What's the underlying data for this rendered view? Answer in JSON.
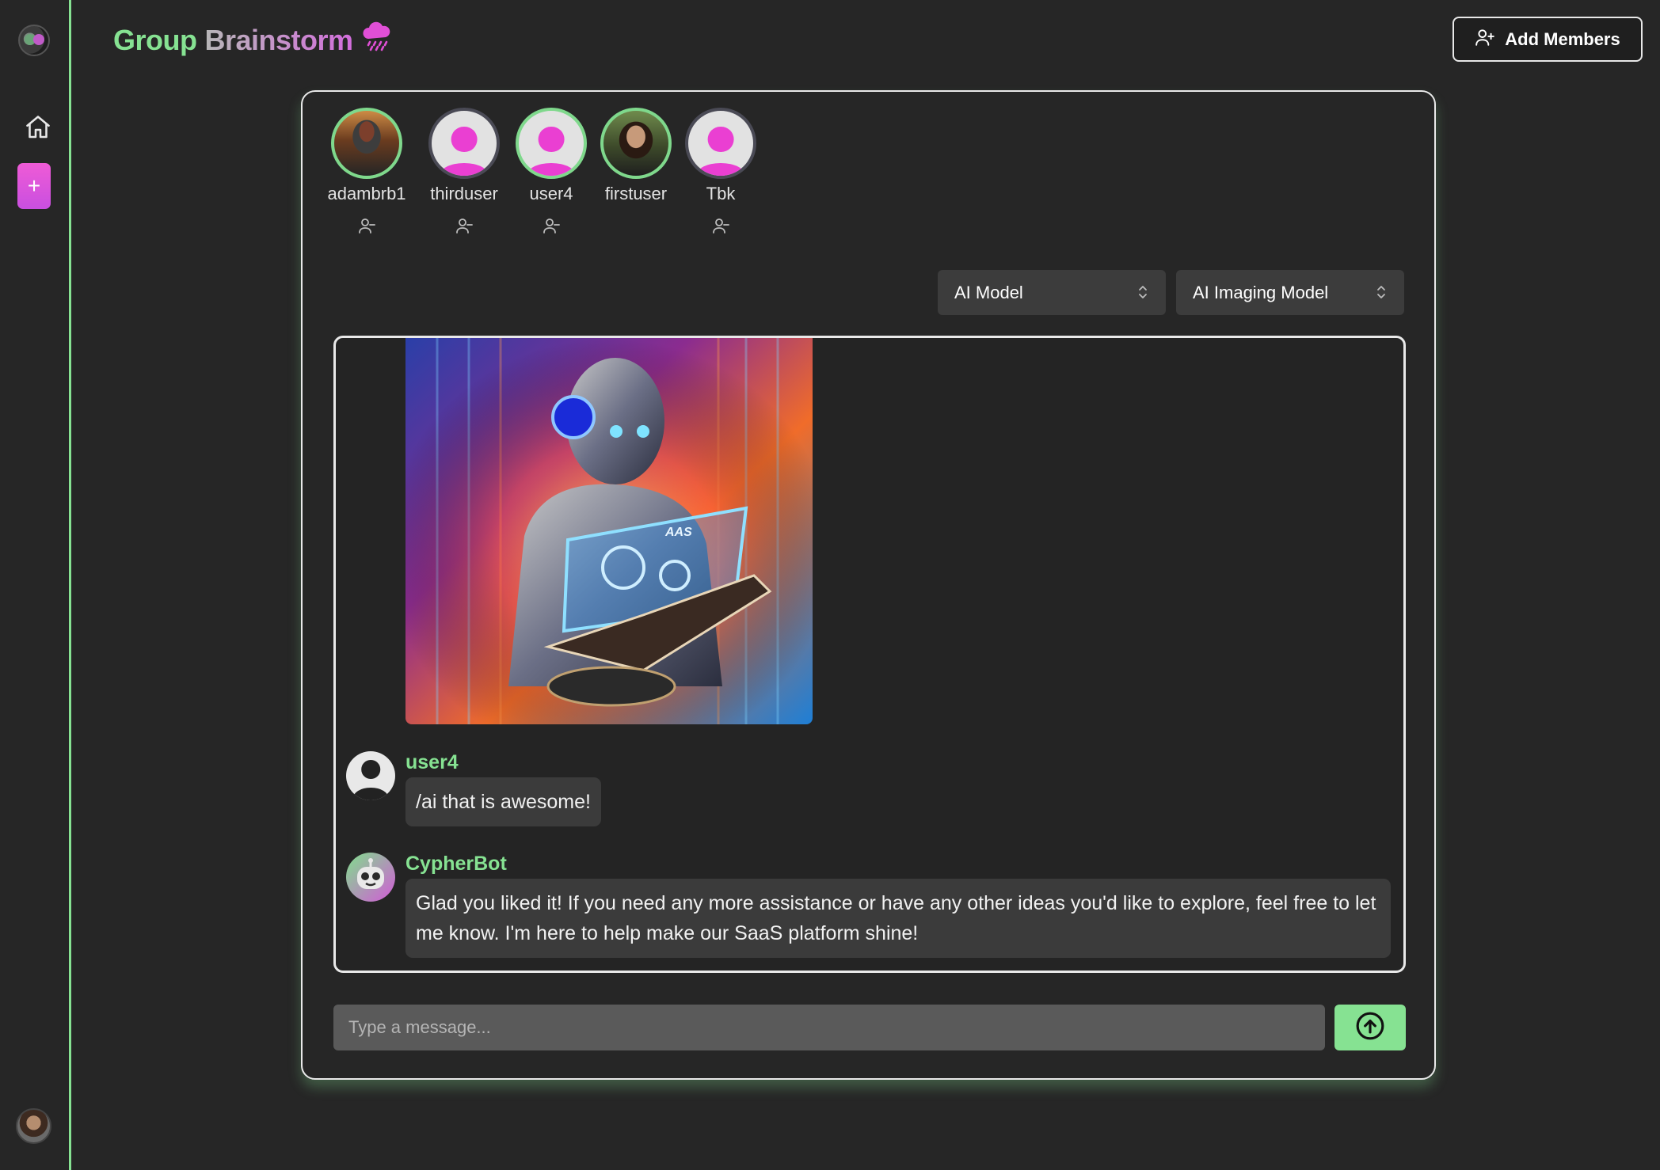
{
  "header": {
    "title_part1": "Group",
    "title_part2": "Brainstorm",
    "title_icon": "rain-cloud-icon",
    "add_members_label": "Add Members"
  },
  "sidebar": {
    "items": [
      {
        "name": "app-logo",
        "icon": "app-logo"
      },
      {
        "name": "home",
        "icon": "home-icon"
      },
      {
        "name": "new-chat",
        "label": "+",
        "icon": "plus-icon"
      },
      {
        "name": "current-user",
        "icon": "user-avatar"
      }
    ]
  },
  "members": [
    {
      "name": "adambrb1",
      "status": "online",
      "avatar": "photo-helmet",
      "removable": true
    },
    {
      "name": "thirduser",
      "status": "offline",
      "avatar": "placeholder",
      "removable": true
    },
    {
      "name": "user4",
      "status": "online",
      "avatar": "placeholder",
      "removable": true
    },
    {
      "name": "firstuser",
      "status": "online",
      "avatar": "photo-man",
      "removable": false
    },
    {
      "name": "Tbk",
      "status": "offline",
      "avatar": "placeholder",
      "removable": true
    }
  ],
  "selects": {
    "ai_model": "AI Model",
    "ai_imaging_model": "AI Imaging Model"
  },
  "chat": {
    "image_alt": "Robot reading a glowing holographic book",
    "image_caption_text": "AAS",
    "messages": [
      {
        "author": "user4",
        "text": "/ai that is awesome!",
        "avatar": "user"
      },
      {
        "author": "CypherBot",
        "text": "Glad you liked it! If you need any more assistance or have any other ideas you'd like to explore, feel free to let me know. I'm here to help make our SaaS platform shine!",
        "avatar": "bot"
      }
    ]
  },
  "composer": {
    "placeholder": "Type a message...",
    "value": ""
  },
  "colors": {
    "accent_green": "#86e292",
    "accent_pink": "#ea3fd2",
    "background": "#262626"
  }
}
